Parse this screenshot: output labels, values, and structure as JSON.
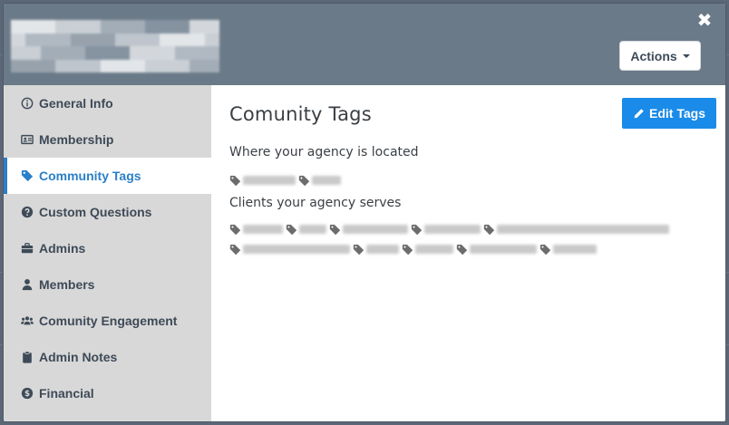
{
  "header": {
    "actions_label": "Actions",
    "close_symbol": "✖",
    "colors": {
      "header_bg": "#6b7a88",
      "accent": "#1a8be8"
    }
  },
  "sidebar": {
    "items": [
      {
        "label": "General Info",
        "icon": "info-circle-icon",
        "active": false
      },
      {
        "label": "Membership",
        "icon": "id-card-icon",
        "active": false
      },
      {
        "label": "Community Tags",
        "icon": "tag-icon",
        "active": true
      },
      {
        "label": "Custom Questions",
        "icon": "question-circle-icon",
        "active": false
      },
      {
        "label": "Admins",
        "icon": "briefcase-icon",
        "active": false
      },
      {
        "label": "Members",
        "icon": "user-icon",
        "active": false
      },
      {
        "label": "Comunity Engagement",
        "icon": "users-icon",
        "active": false
      },
      {
        "label": "Admin Notes",
        "icon": "clipboard-icon",
        "active": false
      },
      {
        "label": "Financial",
        "icon": "dollar-circle-icon",
        "active": false
      }
    ]
  },
  "main": {
    "title": "Comunity Tags",
    "edit_label": "Edit Tags",
    "location_label": "Where your agency is located",
    "clients_label": "Clients your agency serves"
  }
}
